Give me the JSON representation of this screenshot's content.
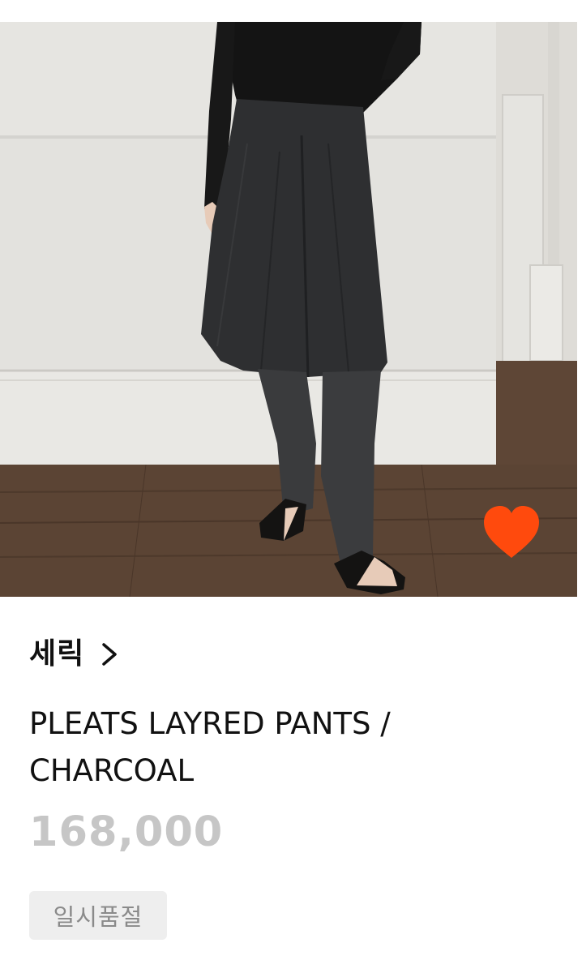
{
  "product": {
    "image_alt": "PLEATS LAYRED PANTS / CHARCOAL",
    "brand": "세릭",
    "title_line1": "PLEATS LAYRED PANTS /",
    "title_line2": "CHARCOAL",
    "price": "168,000",
    "status": "일시품절"
  },
  "icons": {
    "wishlist": "heart-icon",
    "brand_link": "chevron-right-icon"
  },
  "colors": {
    "heart": "#ff4a0d",
    "price": "#c6c6c6",
    "badge_bg": "#eeeeee",
    "badge_text": "#8a8a8a"
  }
}
